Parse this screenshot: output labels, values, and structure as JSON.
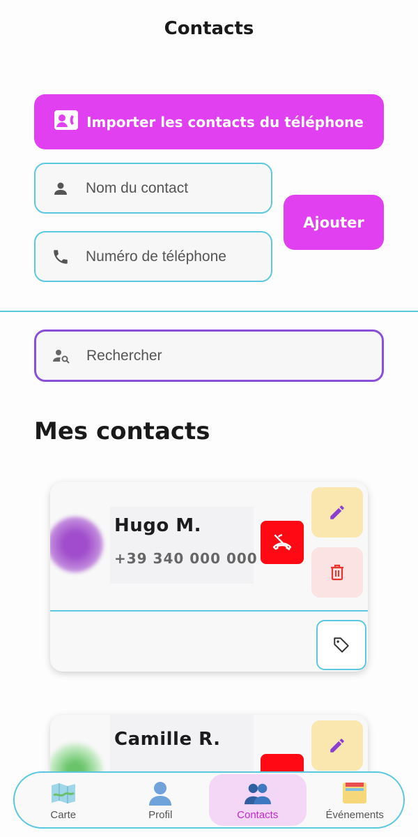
{
  "header": {
    "title": "Contacts"
  },
  "import_button": {
    "label": "Importer les contacts du téléphone"
  },
  "form": {
    "name_placeholder": "Nom du contact",
    "phone_placeholder": "Numéro de téléphone",
    "add_label": "Ajouter"
  },
  "search": {
    "placeholder": "Rechercher"
  },
  "section": {
    "title": "Mes contacts"
  },
  "contacts": [
    {
      "name": "Hugo M.",
      "phone": "+39 340 000 000"
    },
    {
      "name": "Camille R.",
      "phone": ""
    }
  ],
  "nav": {
    "items": [
      {
        "label": "Carte",
        "icon": "map-icon"
      },
      {
        "label": "Profil",
        "icon": "person-icon"
      },
      {
        "label": "Contacts",
        "icon": "people-icon",
        "active": true
      },
      {
        "label": "Événements",
        "icon": "folder-icon"
      }
    ]
  },
  "colors": {
    "accent": "#e040f0",
    "border": "#5bc8e0",
    "search_border": "#8a4fd8",
    "danger": "#ff0a14"
  }
}
